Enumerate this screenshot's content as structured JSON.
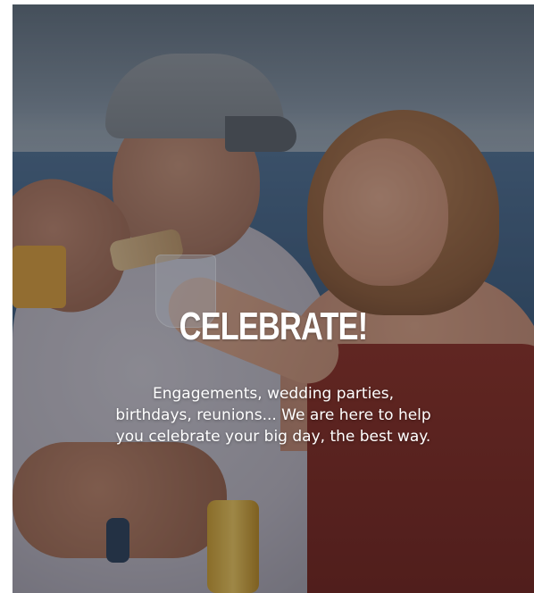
{
  "hero": {
    "heading": "CELEBRATE!",
    "description": "Engagements, wedding parties, birthdays, reunions... We are here to help you celebrate your big day, the best way."
  },
  "colors": {
    "overlay": "#1a2030",
    "text": "#ffffff",
    "dress": "#7c241c",
    "sea": "#3a5878"
  },
  "photo": {
    "subject": "couple toasting on a boat"
  }
}
